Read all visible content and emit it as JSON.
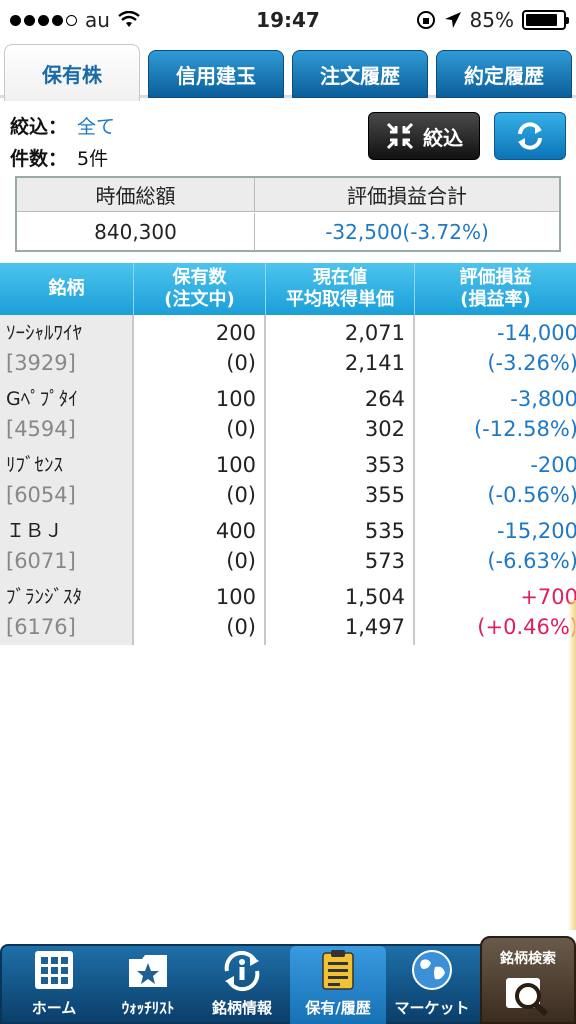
{
  "status_bar": {
    "carrier": "au",
    "time": "19:47",
    "battery": "85%",
    "battery_level": 0.85
  },
  "tabs": [
    {
      "label": "保有株",
      "active": true
    },
    {
      "label": "信用建玉",
      "active": false
    },
    {
      "label": "注文履歴",
      "active": false
    },
    {
      "label": "約定履歴",
      "active": false
    }
  ],
  "filter": {
    "filter_label": "絞込：",
    "filter_value": "全て",
    "count_label": "件数：",
    "count_value": "5件",
    "filter_button": "絞込"
  },
  "summary": {
    "headers": [
      "時価総額",
      "評価損益合計"
    ],
    "market_value": "840,300",
    "total_pl": "-32,500(-3.72%)"
  },
  "holdings": {
    "headers": [
      {
        "line1": "銘柄",
        "line2": ""
      },
      {
        "line1": "保有数",
        "line2": "(注文中)"
      },
      {
        "line1": "現在値",
        "line2": "平均取得単価"
      },
      {
        "line1": "評価損益",
        "line2": "(損益率)"
      }
    ],
    "rows": [
      {
        "name": "ｿｰｼｬﾙﾜｲﾔ",
        "code": "[3929]",
        "qty": "200",
        "pending": "(0)",
        "price": "2,071",
        "avg": "2,141",
        "pl": "-14,000",
        "rate": "(-3.26%)",
        "sign": "neg"
      },
      {
        "name": "Gﾍﾟﾌﾟﾀｲ",
        "code": "[4594]",
        "qty": "100",
        "pending": "(0)",
        "price": "264",
        "avg": "302",
        "pl": "-3,800",
        "rate": "(-12.58%)",
        "sign": "neg"
      },
      {
        "name": "ﾘﾌﾞｾﾝｽ",
        "code": "[6054]",
        "qty": "100",
        "pending": "(0)",
        "price": "353",
        "avg": "355",
        "pl": "-200",
        "rate": "(-0.56%)",
        "sign": "neg"
      },
      {
        "name": "ＩＢＪ",
        "code": "[6071]",
        "qty": "400",
        "pending": "(0)",
        "price": "535",
        "avg": "573",
        "pl": "-15,200",
        "rate": "(-6.63%)",
        "sign": "neg"
      },
      {
        "name": "ﾌﾞﾗﾝｼﾞｽﾀ",
        "code": "[6176]",
        "qty": "100",
        "pending": "(0)",
        "price": "1,504",
        "avg": "1,497",
        "pl": "+700",
        "rate": "(+0.46%)",
        "sign": "pos"
      }
    ]
  },
  "bottom_nav": [
    {
      "label": "ホーム",
      "icon": "home-grid-icon"
    },
    {
      "label": "ｳｫｯﾁﾘｽﾄ",
      "icon": "star-folder-icon"
    },
    {
      "label": "銘柄情報",
      "icon": "info-refresh-icon"
    },
    {
      "label": "保有/履歴",
      "icon": "clipboard-icon",
      "active": true
    },
    {
      "label": "マーケット",
      "icon": "globe-icon"
    }
  ],
  "search_button": {
    "label": "銘柄検索",
    "icon": "magnifier-icon"
  },
  "colors": {
    "negative": "#1f78c4",
    "positive": "#e0205a",
    "tab_blue": "#0b5f9a",
    "header_cyan": "#1b9fd8"
  }
}
